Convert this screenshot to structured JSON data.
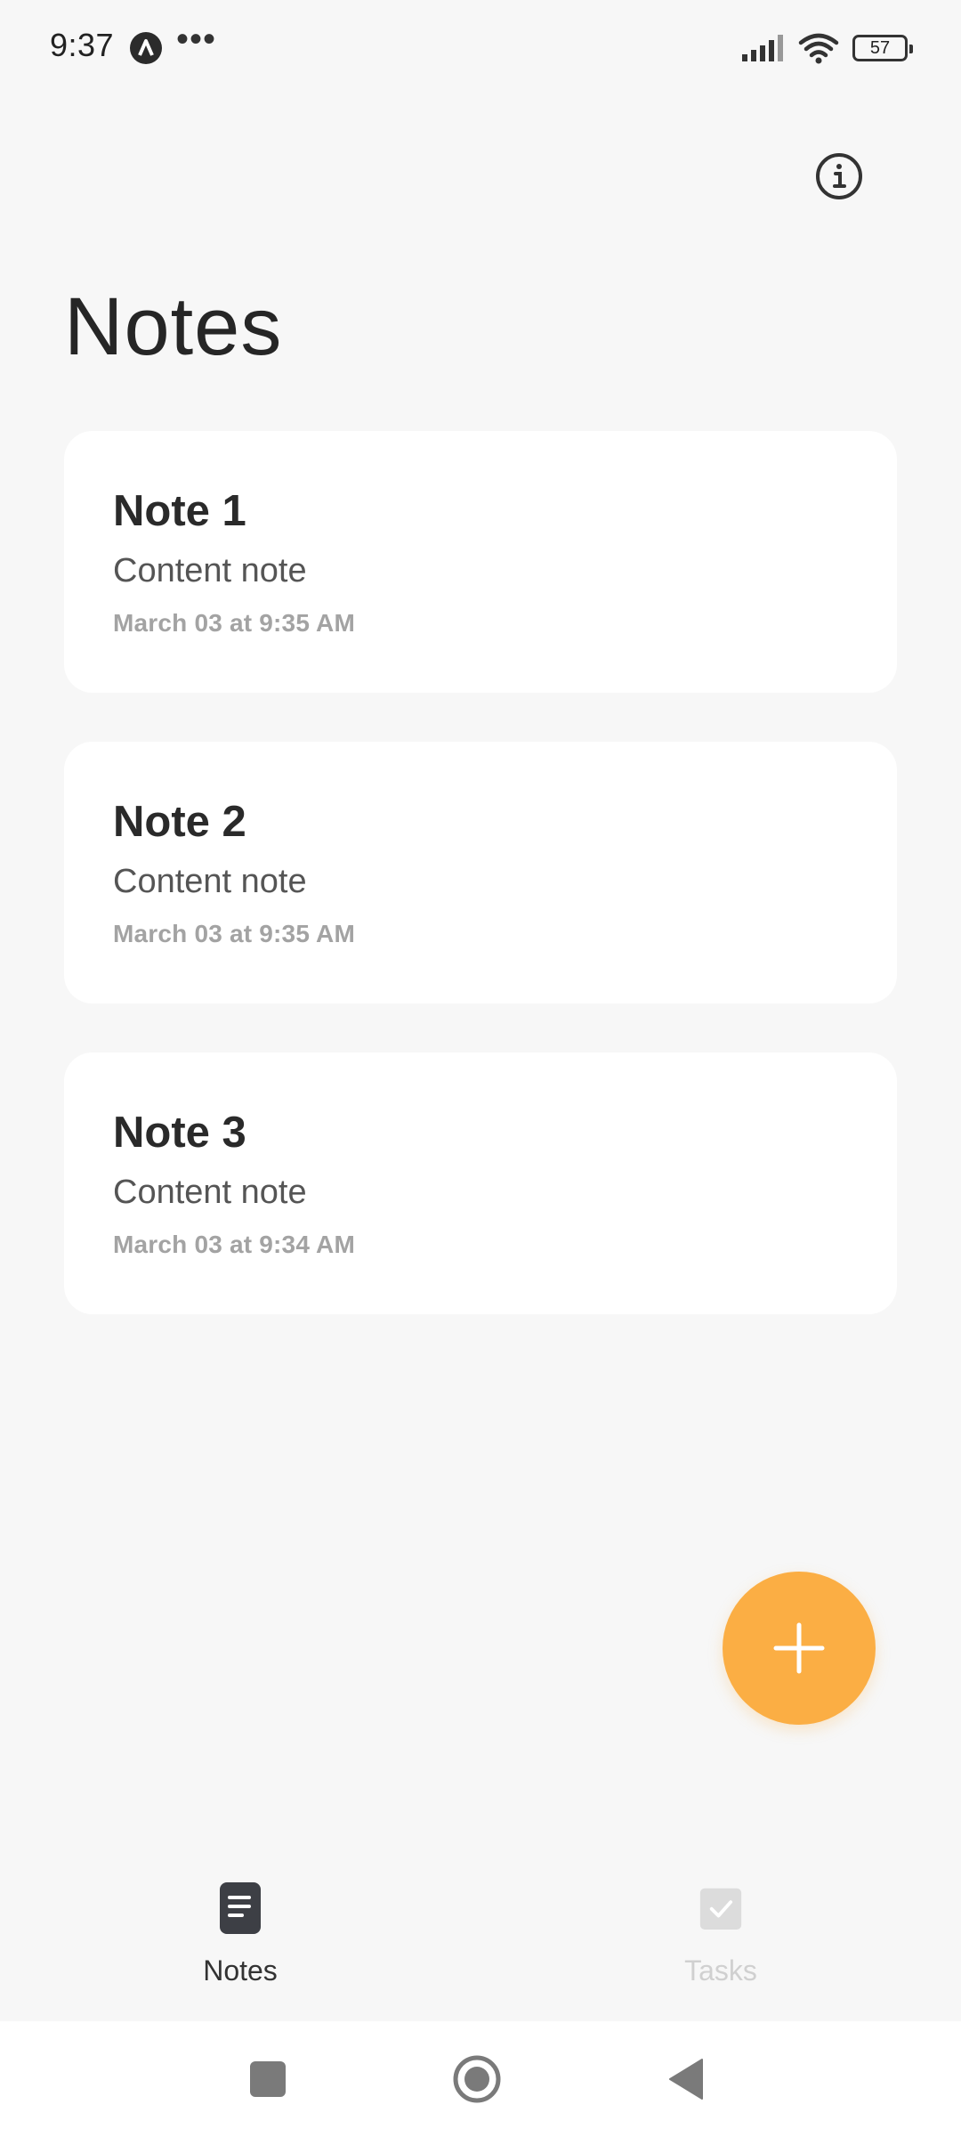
{
  "status_bar": {
    "time": "9:37",
    "more_indicator": "•••",
    "battery_level": "57"
  },
  "header": {
    "title": "Notes",
    "info_icon": "info-circle-icon"
  },
  "notes": [
    {
      "title": "Note 1",
      "content": "Content note",
      "date": "March 03 at 9:35 AM"
    },
    {
      "title": "Note 2",
      "content": "Content note",
      "date": "March 03 at 9:35 AM"
    },
    {
      "title": "Note 3",
      "content": "Content note",
      "date": "March 03 at 9:34 AM"
    }
  ],
  "fab": {
    "icon": "plus-icon"
  },
  "bottom_nav": {
    "notes_label": "Notes",
    "tasks_label": "Tasks",
    "active_tab": "Notes"
  },
  "system_nav": {
    "recents_icon": "square-icon",
    "home_icon": "circle-icon",
    "back_icon": "triangle-back-icon"
  },
  "colors": {
    "background": "#f7f7f7",
    "card": "#ffffff",
    "accent": "#fbae44",
    "nav_active": "#3d3f45",
    "nav_inactive": "#d0d0d0"
  }
}
